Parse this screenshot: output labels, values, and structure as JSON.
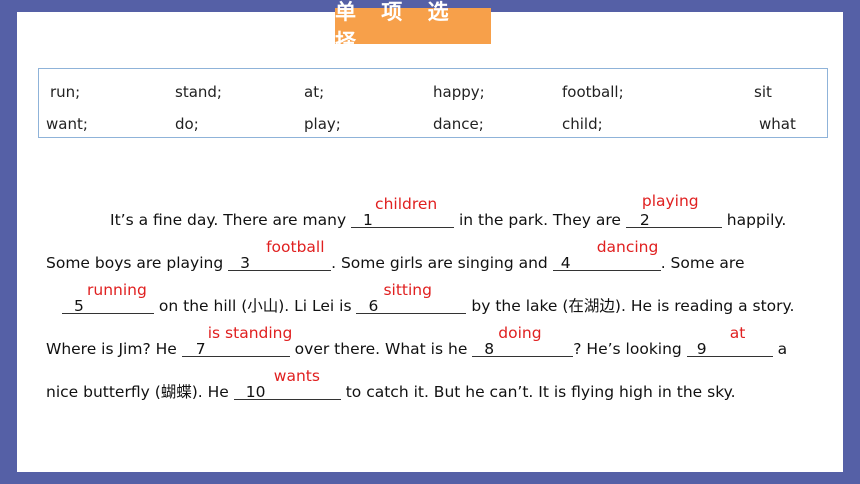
{
  "title": "单 项 选 择",
  "word_bank": {
    "row1": [
      "run;",
      "stand;",
      "at;",
      "happy;",
      "football;",
      "sit"
    ],
    "row2": [
      "want;",
      "do;",
      "play;",
      "dance;",
      "child;",
      "what"
    ]
  },
  "passage": {
    "l1": {
      "a": "It’s a fine day. There are many ",
      "n1": "1",
      "ans1": "children",
      "b": " in the park. They are ",
      "n2": "2",
      "ans2": "playing",
      "c": " happily."
    },
    "l2": {
      "a": "Some boys are playing ",
      "n3": "3",
      "ans3": "football",
      "b": ". Some girls are singing and ",
      "n4": "4",
      "ans4": "dancing",
      "c": ". Some are"
    },
    "l3": {
      "n5": "5",
      "ans5": "running",
      "a": " on the hill (小山). Li Lei is ",
      "n6": "6",
      "ans6": "sitting",
      "b": " by the lake (在湖边). He is reading a story."
    },
    "l4": {
      "a": "Where is Jim? He ",
      "n7": "7",
      "ans7": "is standing",
      "b": " over there. What is he ",
      "n8": "8",
      "ans8": "doing",
      "c": "? He’s looking ",
      "n9": "9",
      "ans9": "at",
      "d": " a"
    },
    "l5": {
      "a": "nice butterfly (蝴蝶). He ",
      "n10": "10",
      "ans10": "wants",
      "b": " to catch it. But he can’t. It is flying high in the sky."
    }
  }
}
